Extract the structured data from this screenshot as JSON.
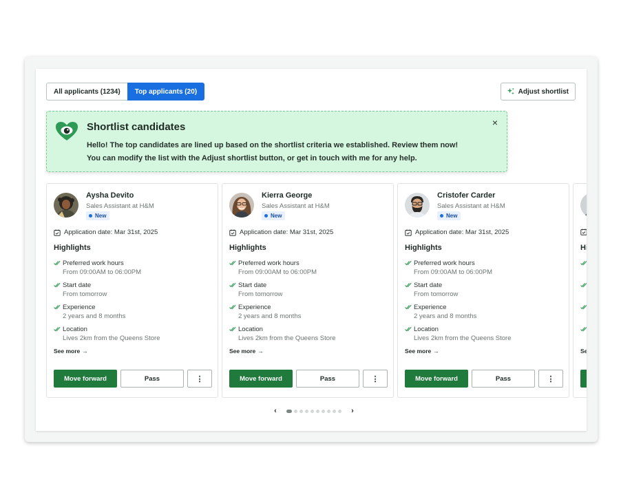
{
  "tabs": [
    {
      "label": "All applicants (1234)",
      "active": false
    },
    {
      "label": "Top applicants (20)",
      "active": true
    }
  ],
  "adjust_button": {
    "label": "Adjust shortlist",
    "icon": "sparkle-icon"
  },
  "banner": {
    "title": "Shortlist candidates",
    "line1": "Hello! The top candidates are lined up based on the shortlist criteria we established. Review them now!",
    "line2": "You can modify the list with the Adjust shortlist button, or get in touch with me for any help.",
    "close_icon": "×",
    "color": "#d5f7df"
  },
  "cards": [
    {
      "name": "Aysha Devito",
      "role": "Sales Assistant at H&M",
      "badge": "New",
      "application_date": "Application date: Mar 31st, 2025",
      "highlights_title": "Highlights",
      "highlights": [
        {
          "label": "Preferred work hours",
          "value": "From 09:00AM to 06:00PM"
        },
        {
          "label": "Start date",
          "value": "From tomorrow"
        },
        {
          "label": "Experience",
          "value": "2 years and 8 months"
        },
        {
          "label": "Location",
          "value": "Lives 2km from the Queens Store"
        }
      ],
      "see_more": "See more",
      "forward_label": "Move forward",
      "pass_label": "Pass",
      "more_label": "⋮"
    },
    {
      "name": "Kierra George",
      "role": "Sales Assistant at H&M",
      "badge": "New",
      "application_date": "Application date: Mar 31st, 2025",
      "highlights_title": "Highlights",
      "highlights": [
        {
          "label": "Preferred work hours",
          "value": "From 09:00AM to 06:00PM"
        },
        {
          "label": "Start date",
          "value": "From tomorrow"
        },
        {
          "label": "Experience",
          "value": "2 years and 8 months"
        },
        {
          "label": "Location",
          "value": "Lives 2km from the Queens Store"
        }
      ],
      "see_more": "See more",
      "forward_label": "Move forward",
      "pass_label": "Pass",
      "more_label": "⋮"
    },
    {
      "name": "Cristofer Carder",
      "role": "Sales Assistant at H&M",
      "badge": "New",
      "application_date": "Application date: Mar 31st, 2025",
      "highlights_title": "Highlights",
      "highlights": [
        {
          "label": "Preferred work hours",
          "value": "From 09:00AM to 06:00PM"
        },
        {
          "label": "Start date",
          "value": "From tomorrow"
        },
        {
          "label": "Experience",
          "value": "2 years and 8 months"
        },
        {
          "label": "Location",
          "value": "Lives 2km from the Queens Store"
        }
      ],
      "see_more": "See more",
      "forward_label": "Move forward",
      "pass_label": "Pass",
      "more_label": "⋮"
    },
    {
      "name": "",
      "role": "",
      "badge": "",
      "application_date": "",
      "highlights_title": "Hi",
      "highlights": [
        {
          "label": "",
          "value": ""
        },
        {
          "label": "",
          "value": ""
        },
        {
          "label": "",
          "value": ""
        },
        {
          "label": "",
          "value": ""
        }
      ],
      "see_more": "Se",
      "forward_label": "",
      "pass_label": "",
      "more_label": ""
    }
  ],
  "pager": {
    "prev": "‹",
    "next": "›",
    "total_pages": 10,
    "current_page": 1
  },
  "colors": {
    "primary_blue": "#1a6fe0",
    "forward_green": "#1f7a3c",
    "check_green": "#2e9a55",
    "new_badge_bg": "#e8f0fd"
  }
}
